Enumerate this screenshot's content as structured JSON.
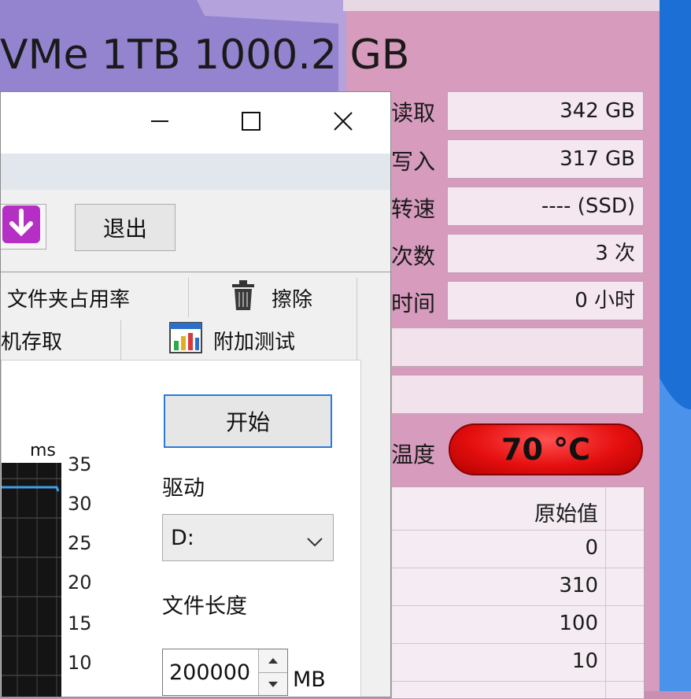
{
  "disk_info": {
    "model_text": "VMe 1TB 1000.2 GB",
    "rows": [
      {
        "label": "读取",
        "value": "342 GB"
      },
      {
        "label": "写入",
        "value": "317 GB"
      },
      {
        "label": "转速",
        "value": "---- (SSD)"
      },
      {
        "label": "次数",
        "value": "3 次"
      },
      {
        "label": "时间",
        "value": "0 小时"
      }
    ],
    "temperature_label": "温度",
    "temperature_value": "70 °C",
    "smart_table": {
      "header": "原始值",
      "values": [
        "0",
        "310",
        "100",
        "10"
      ]
    }
  },
  "benchmark_window": {
    "toolbar": {
      "exit_label": "退出"
    },
    "tabs": [
      {
        "label": "文件夹占用率",
        "icon": "folder-usage-icon"
      },
      {
        "label": "擦除",
        "icon": "trash-icon"
      },
      {
        "label": "机存取",
        "icon": ""
      },
      {
        "label": "附加测试",
        "icon": "chart-icon"
      }
    ],
    "graph": {
      "unit": "ms",
      "ticks": [
        "35",
        "30",
        "25",
        "20",
        "15",
        "10"
      ]
    },
    "start_label": "开始",
    "drive_label": "驱动",
    "drive_value": "D:",
    "file_length_label": "文件长度",
    "file_length_value": "200000",
    "file_length_unit": "MB"
  },
  "colors": {
    "temperature_red": "#e50f0f",
    "desktop_blue": "#1c6fd4",
    "pink_bg": "#c98fb3"
  }
}
